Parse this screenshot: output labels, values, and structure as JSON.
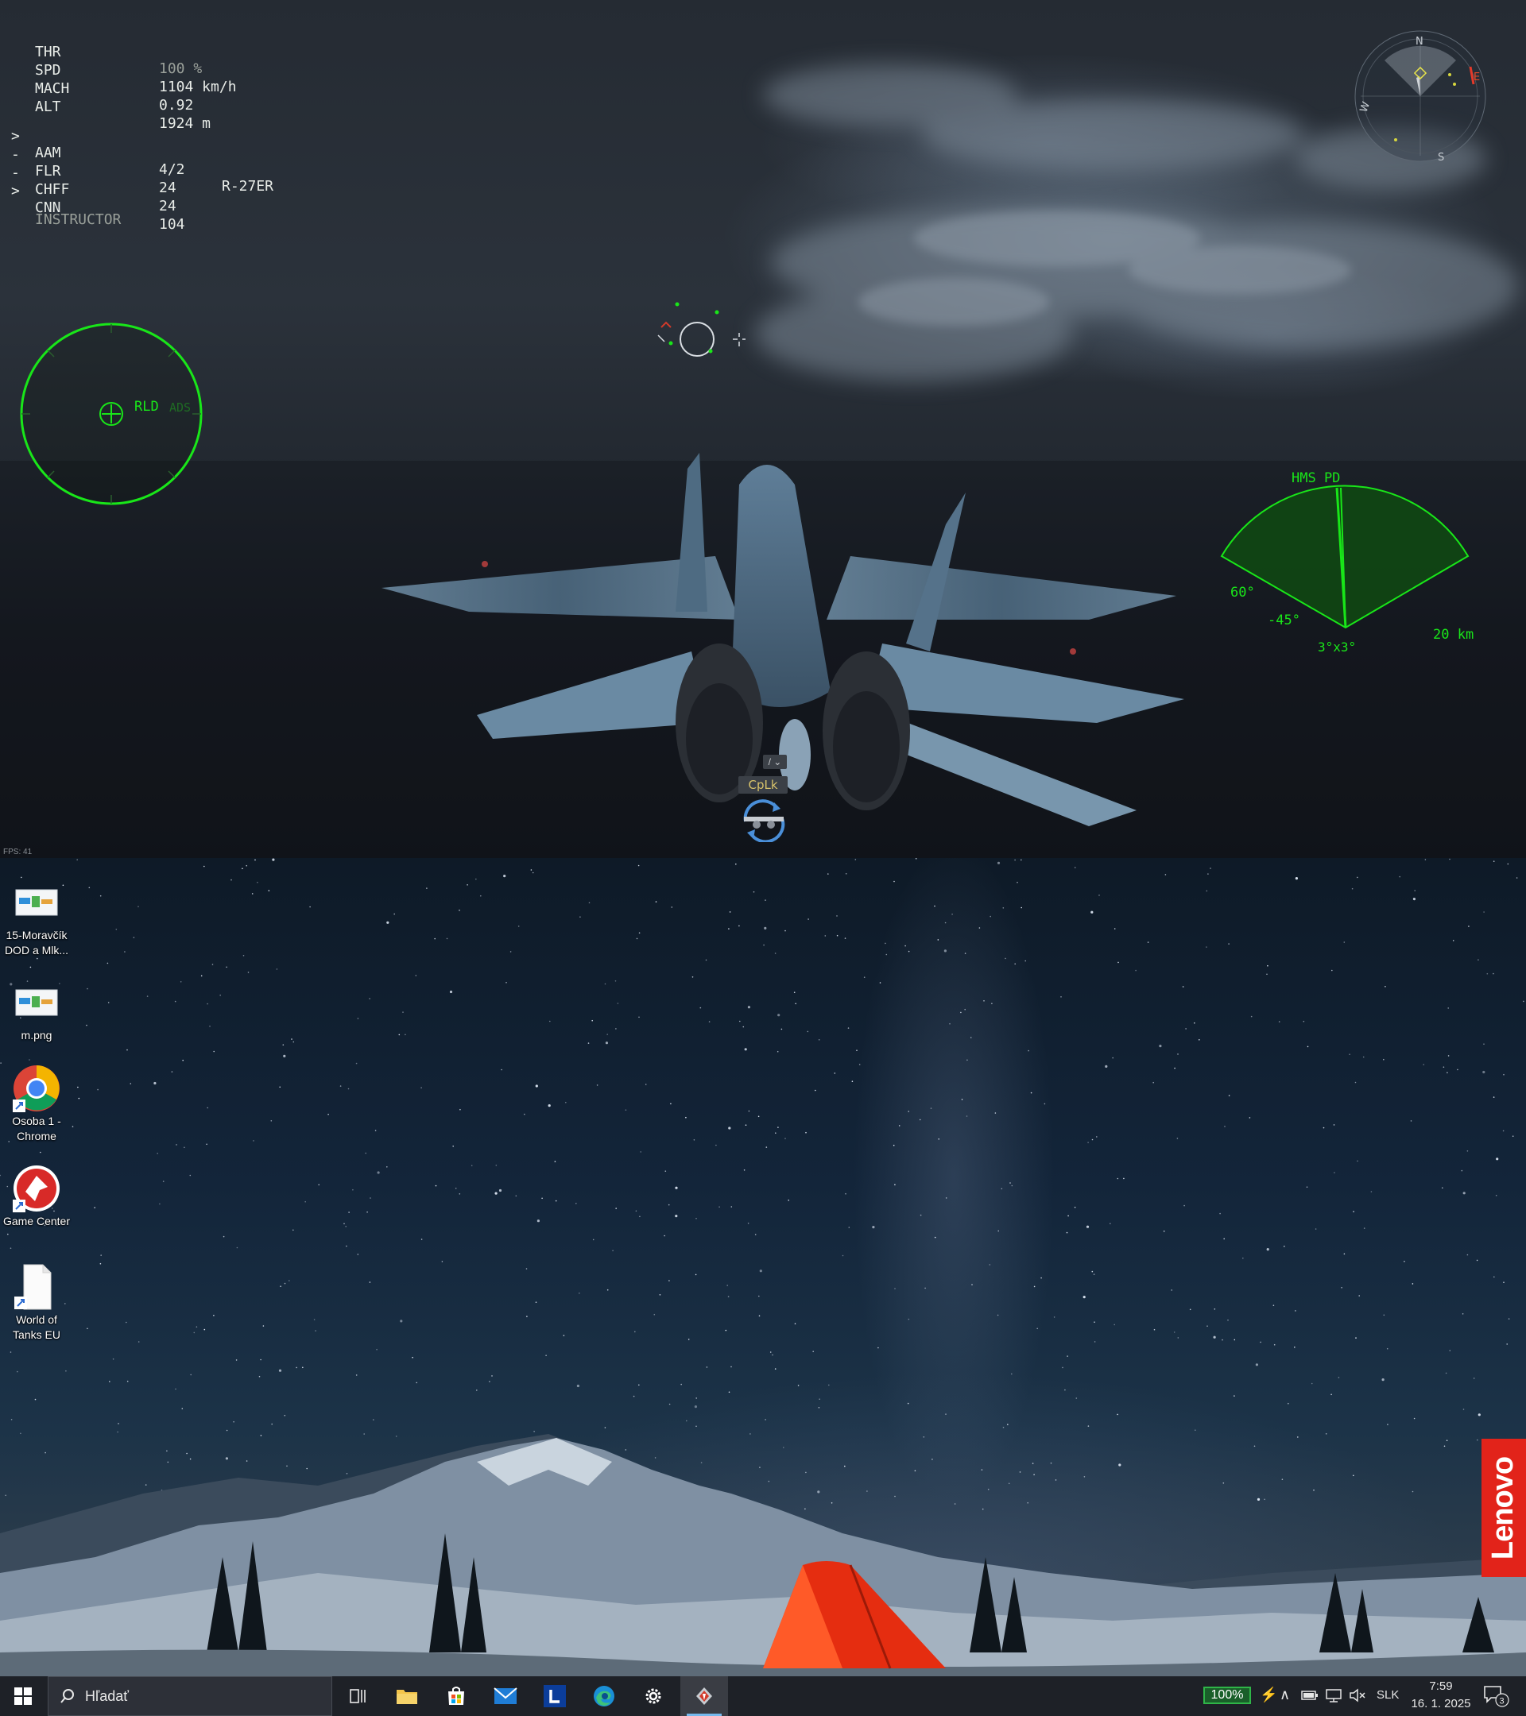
{
  "game": {
    "hud": {
      "rows": [
        {
          "mark": "",
          "label": "THR",
          "value": "100 %",
          "extra": ""
        },
        {
          "mark": "",
          "label": "SPD",
          "value": "1104 km/h",
          "extra": ""
        },
        {
          "mark": "",
          "label": "MACH",
          "value": "0.92",
          "extra": ""
        },
        {
          "mark": "",
          "label": "ALT",
          "value": "1924 m",
          "extra": ""
        }
      ],
      "weapons": [
        {
          "mark": ">",
          "label": "AAM",
          "value": "4/2",
          "extra": "R-27ER"
        },
        {
          "mark": "-",
          "label": "FLR",
          "value": "24",
          "extra": ""
        },
        {
          "mark": "-",
          "label": "CHFF",
          "value": "24",
          "extra": ""
        },
        {
          "mark": ">",
          "label": "CNN",
          "value": "104",
          "extra": ""
        }
      ],
      "mode": "INSTRUCTOR"
    },
    "radar": {
      "mode": "RLD",
      "mode2": "ADS"
    },
    "scope": {
      "title": "HMS PD",
      "left_angle": "60°",
      "elevation": "-45°",
      "scan": "3°x3°",
      "range": "20 km"
    },
    "compass": {
      "n": "N",
      "w": "W",
      "s": "S",
      "e": "E"
    },
    "weapon_status": {
      "slash_label": "/ ⌄",
      "lock_label": "CpLk"
    },
    "fps": "FPS: 41",
    "colors": {
      "hud_green": "#19e619",
      "scope_fill": "#0f4a12"
    }
  },
  "desktop": {
    "icons": [
      {
        "label": "15-Moravčík DOD a Mlk...",
        "icon": "image-file-icon"
      },
      {
        "label": "m.png",
        "icon": "image-file-icon"
      },
      {
        "label": "Osoba 1 - Chrome",
        "icon": "chrome-icon"
      },
      {
        "label": "Game Center",
        "icon": "wargaming-icon"
      },
      {
        "label": "World of Tanks EU",
        "icon": "blank-file-icon"
      }
    ],
    "brand": "Lenovo"
  },
  "taskbar": {
    "search_placeholder": "Hľadať",
    "battery": "100%",
    "language": "SLK",
    "time": "7:59",
    "date": "16. 1. 2025",
    "notifications": "3"
  }
}
